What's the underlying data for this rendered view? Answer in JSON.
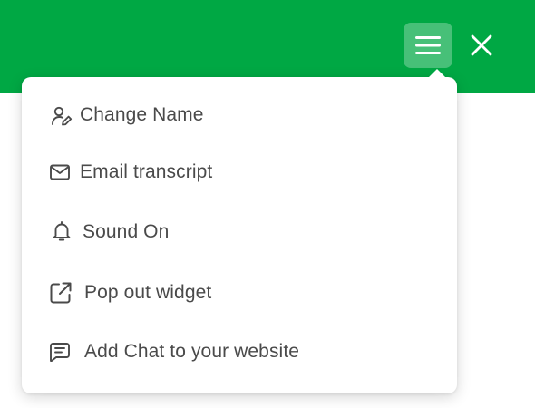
{
  "header": {
    "menu_icon": "hamburger-menu-icon",
    "close_icon": "close-icon",
    "brand_color": "#00a844"
  },
  "menu": {
    "items": [
      {
        "label": "Change Name",
        "icon": "user-edit-icon"
      },
      {
        "label": "Email transcript",
        "icon": "mail-icon"
      },
      {
        "label": "Sound On",
        "icon": "bell-icon"
      },
      {
        "label": "Pop out widget",
        "icon": "external-link-icon"
      },
      {
        "label": "Add Chat to your website",
        "icon": "chat-bubble-icon"
      }
    ]
  }
}
